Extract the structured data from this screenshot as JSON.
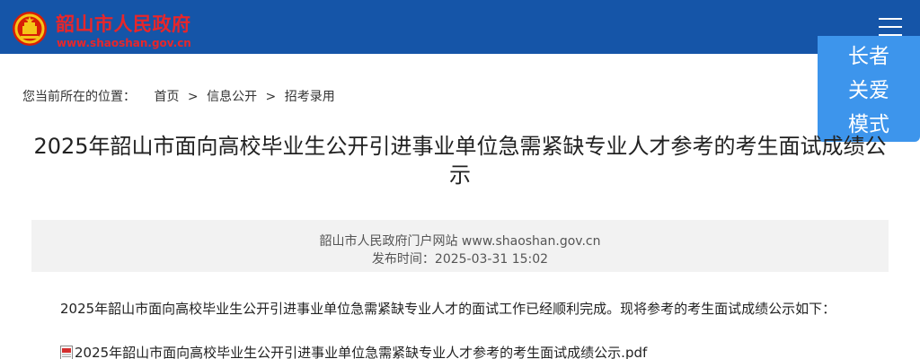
{
  "header": {
    "site_name": "韶山市人民政府",
    "site_url": "www.shaoshan.gov.cn"
  },
  "care_mode": {
    "lines": [
      "长者",
      "关爱",
      "模式"
    ]
  },
  "breadcrumb": {
    "label": "您当前所在的位置：",
    "items": [
      "首页",
      "信息公开",
      "招考录用"
    ],
    "separator": ">"
  },
  "article": {
    "title": "2025年韶山市面向高校毕业生公开引进事业单位急需紧缺专业人才参考的考生面试成绩公示",
    "source": "韶山市人民政府门户网站 www.shaoshan.gov.cn",
    "publish_time": "发布时间：2025-03-31 15:02",
    "body": "2025年韶山市面向高校毕业生公开引进事业单位急需紧缺专业人才的面试工作已经顺利完成。现将参考的考生面试成绩公示如下：",
    "attachment": "2025年韶山市面向高校毕业生公开引进事业单位急需紧缺专业人才参考的考生面试成绩公示.pdf"
  },
  "colors": {
    "header_bg": "#1555a8",
    "brand_red": "#e8262a",
    "care_mode_bg": "#3d95ec"
  },
  "icons": {
    "emblem": "national-emblem-icon",
    "menu": "hamburger-menu-icon",
    "attachment": "pdf-file-icon"
  }
}
